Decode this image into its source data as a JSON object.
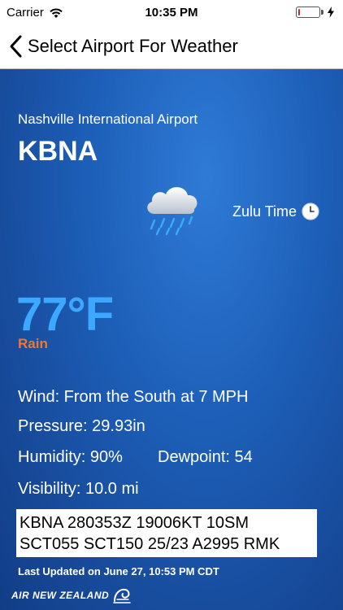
{
  "status_bar": {
    "carrier": "Carrier",
    "time": "10:35 PM",
    "battery_level": 0.1,
    "battery_color": "#e02424"
  },
  "nav": {
    "back_icon": "chevron-left-icon",
    "title": "Select Airport For Weather"
  },
  "airport": {
    "name": "Nashville International Airport",
    "code": "KBNA"
  },
  "weather": {
    "icon": "rain-cloud-icon",
    "zulu_label": "Zulu Time",
    "zulu_icon": "clock-icon",
    "temperature": "77°F",
    "condition": "Rain",
    "wind": "Wind: From the South at 7 MPH",
    "pressure": "Pressure: 29.93in",
    "humidity": "Humidity: 90%",
    "dewpoint": "Dewpoint: 54",
    "visibility": "Visibility: 10.0 mi"
  },
  "metar": {
    "line1": "KBNA 280353Z 19006KT 10SM",
    "line2": "SCT055 SCT150 25/23 A2995 RMK"
  },
  "last_updated": "Last Updated on June 27, 10:53 PM CDT",
  "brand": {
    "text": "AIR NEW ZEALAND",
    "logo": "koru-logo-icon"
  },
  "colors": {
    "panel_blue": "#1d5fb8",
    "temperature": "#3da8ff",
    "condition": "#f0782a"
  }
}
